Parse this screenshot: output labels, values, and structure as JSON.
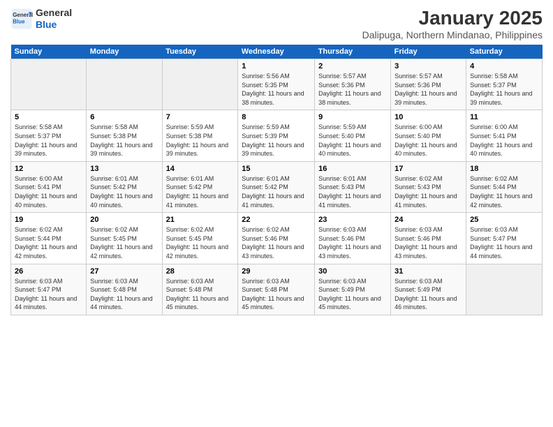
{
  "header": {
    "logo_line1": "General",
    "logo_line2": "Blue",
    "title": "January 2025",
    "subtitle": "Dalipuga, Northern Mindanao, Philippines"
  },
  "days_of_week": [
    "Sunday",
    "Monday",
    "Tuesday",
    "Wednesday",
    "Thursday",
    "Friday",
    "Saturday"
  ],
  "weeks": [
    [
      {
        "num": "",
        "empty": true
      },
      {
        "num": "",
        "empty": true
      },
      {
        "num": "",
        "empty": true
      },
      {
        "num": "1",
        "sunrise": "5:56 AM",
        "sunset": "5:35 PM",
        "daylight": "11 hours and 38 minutes."
      },
      {
        "num": "2",
        "sunrise": "5:57 AM",
        "sunset": "5:36 PM",
        "daylight": "11 hours and 38 minutes."
      },
      {
        "num": "3",
        "sunrise": "5:57 AM",
        "sunset": "5:36 PM",
        "daylight": "11 hours and 39 minutes."
      },
      {
        "num": "4",
        "sunrise": "5:58 AM",
        "sunset": "5:37 PM",
        "daylight": "11 hours and 39 minutes."
      }
    ],
    [
      {
        "num": "5",
        "sunrise": "5:58 AM",
        "sunset": "5:37 PM",
        "daylight": "11 hours and 39 minutes."
      },
      {
        "num": "6",
        "sunrise": "5:58 AM",
        "sunset": "5:38 PM",
        "daylight": "11 hours and 39 minutes."
      },
      {
        "num": "7",
        "sunrise": "5:59 AM",
        "sunset": "5:38 PM",
        "daylight": "11 hours and 39 minutes."
      },
      {
        "num": "8",
        "sunrise": "5:59 AM",
        "sunset": "5:39 PM",
        "daylight": "11 hours and 39 minutes."
      },
      {
        "num": "9",
        "sunrise": "5:59 AM",
        "sunset": "5:40 PM",
        "daylight": "11 hours and 40 minutes."
      },
      {
        "num": "10",
        "sunrise": "6:00 AM",
        "sunset": "5:40 PM",
        "daylight": "11 hours and 40 minutes."
      },
      {
        "num": "11",
        "sunrise": "6:00 AM",
        "sunset": "5:41 PM",
        "daylight": "11 hours and 40 minutes."
      }
    ],
    [
      {
        "num": "12",
        "sunrise": "6:00 AM",
        "sunset": "5:41 PM",
        "daylight": "11 hours and 40 minutes."
      },
      {
        "num": "13",
        "sunrise": "6:01 AM",
        "sunset": "5:42 PM",
        "daylight": "11 hours and 40 minutes."
      },
      {
        "num": "14",
        "sunrise": "6:01 AM",
        "sunset": "5:42 PM",
        "daylight": "11 hours and 41 minutes."
      },
      {
        "num": "15",
        "sunrise": "6:01 AM",
        "sunset": "5:42 PM",
        "daylight": "11 hours and 41 minutes."
      },
      {
        "num": "16",
        "sunrise": "6:01 AM",
        "sunset": "5:43 PM",
        "daylight": "11 hours and 41 minutes."
      },
      {
        "num": "17",
        "sunrise": "6:02 AM",
        "sunset": "5:43 PM",
        "daylight": "11 hours and 41 minutes."
      },
      {
        "num": "18",
        "sunrise": "6:02 AM",
        "sunset": "5:44 PM",
        "daylight": "11 hours and 42 minutes."
      }
    ],
    [
      {
        "num": "19",
        "sunrise": "6:02 AM",
        "sunset": "5:44 PM",
        "daylight": "11 hours and 42 minutes."
      },
      {
        "num": "20",
        "sunrise": "6:02 AM",
        "sunset": "5:45 PM",
        "daylight": "11 hours and 42 minutes."
      },
      {
        "num": "21",
        "sunrise": "6:02 AM",
        "sunset": "5:45 PM",
        "daylight": "11 hours and 42 minutes."
      },
      {
        "num": "22",
        "sunrise": "6:02 AM",
        "sunset": "5:46 PM",
        "daylight": "11 hours and 43 minutes."
      },
      {
        "num": "23",
        "sunrise": "6:03 AM",
        "sunset": "5:46 PM",
        "daylight": "11 hours and 43 minutes."
      },
      {
        "num": "24",
        "sunrise": "6:03 AM",
        "sunset": "5:46 PM",
        "daylight": "11 hours and 43 minutes."
      },
      {
        "num": "25",
        "sunrise": "6:03 AM",
        "sunset": "5:47 PM",
        "daylight": "11 hours and 44 minutes."
      }
    ],
    [
      {
        "num": "26",
        "sunrise": "6:03 AM",
        "sunset": "5:47 PM",
        "daylight": "11 hours and 44 minutes."
      },
      {
        "num": "27",
        "sunrise": "6:03 AM",
        "sunset": "5:48 PM",
        "daylight": "11 hours and 44 minutes."
      },
      {
        "num": "28",
        "sunrise": "6:03 AM",
        "sunset": "5:48 PM",
        "daylight": "11 hours and 45 minutes."
      },
      {
        "num": "29",
        "sunrise": "6:03 AM",
        "sunset": "5:48 PM",
        "daylight": "11 hours and 45 minutes."
      },
      {
        "num": "30",
        "sunrise": "6:03 AM",
        "sunset": "5:49 PM",
        "daylight": "11 hours and 45 minutes."
      },
      {
        "num": "31",
        "sunrise": "6:03 AM",
        "sunset": "5:49 PM",
        "daylight": "11 hours and 46 minutes."
      },
      {
        "num": "",
        "empty": true
      }
    ]
  ],
  "labels": {
    "sunrise": "Sunrise:",
    "sunset": "Sunset:",
    "daylight": "Daylight:"
  }
}
